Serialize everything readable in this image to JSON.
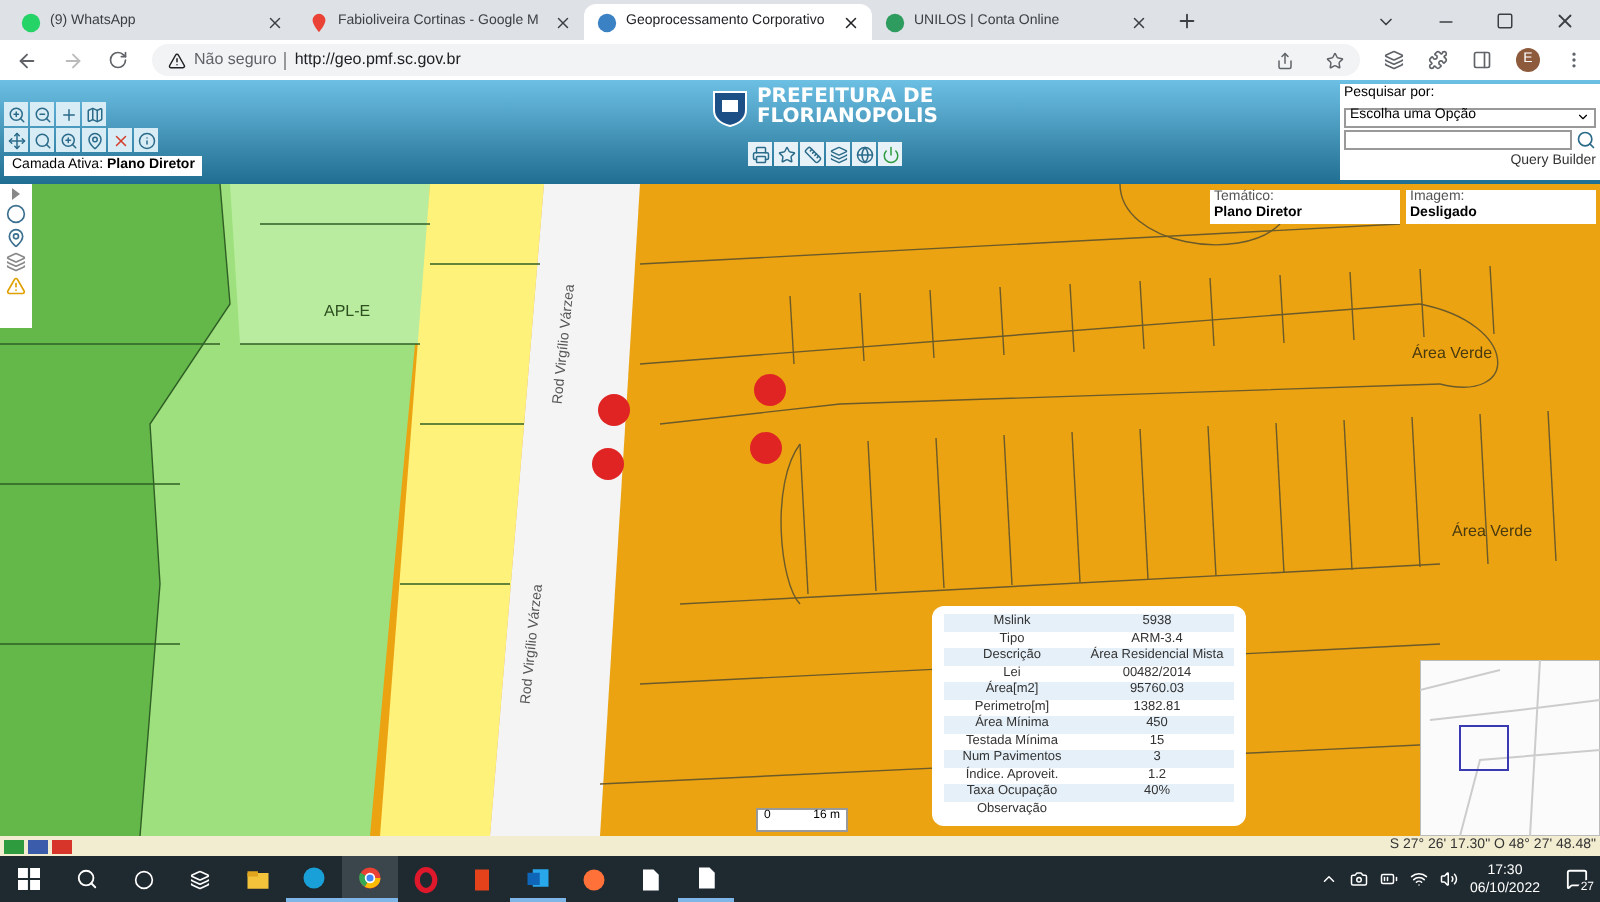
{
  "browser": {
    "tabs": [
      {
        "title": "(9) WhatsApp",
        "kind": "whatsapp",
        "selected": false
      },
      {
        "title": "Fabioliveira Cortinas - Google M",
        "kind": "maps",
        "selected": false
      },
      {
        "title": "Geoprocessamento Corporativo",
        "kind": "globe",
        "selected": true
      },
      {
        "title": "UNILOS | Conta Online",
        "kind": "unilos",
        "selected": false
      }
    ],
    "address": {
      "security": "Não seguro",
      "url": "http://geo.pmf.sc.gov.br"
    },
    "profile": "E"
  },
  "header": {
    "logo_lines": [
      "PREFEITURA DE",
      "FLORIANOPOLIS"
    ],
    "active_layer": {
      "label": "Camada Ativa:",
      "value": "Plano Diretor"
    },
    "search": {
      "label": "Pesquisar por:",
      "select": "Escolha uma Opção",
      "query_builder": "Query Builder"
    }
  },
  "map": {
    "thematic": {
      "label": "Temático:",
      "value": "Plano Diretor"
    },
    "image": {
      "label": "Imagem:",
      "value": "Desligado"
    },
    "zone_label": "APL-E",
    "area_labels": [
      "Área Verde",
      "Área Verde"
    ],
    "road_labels": [
      "Rod Virgílio Várzea",
      "Rod Virgílio Várzea"
    ],
    "info": [
      {
        "label": "Mslink",
        "value": "5938"
      },
      {
        "label": "Tipo",
        "value": "ARM-3.4"
      },
      {
        "label": "Descrição",
        "value": "Área Residencial Mista"
      },
      {
        "label": "Lei",
        "value": "00482/2014"
      },
      {
        "label": "Área[m2]",
        "value": "95760.03"
      },
      {
        "label": "Perimetro[m]",
        "value": "1382.81"
      },
      {
        "label": "Área Mínima",
        "value": "450"
      },
      {
        "label": "Testada Mínima",
        "value": "15"
      },
      {
        "label": "Num Pavimentos",
        "value": "3"
      },
      {
        "label": "Índice. Aproveit.",
        "value": "1.2"
      },
      {
        "label": "Taxa Ocupação",
        "value": "40%"
      },
      {
        "label": "Observação"
      }
    ],
    "scale": {
      "start": "0",
      "end": "16 m"
    },
    "coordinates": "S 27° 26' 17.30\" O 48° 27' 48.48\""
  },
  "taskbar": {
    "apps": [
      {
        "kind": "explorer",
        "running": false,
        "selected": false
      },
      {
        "kind": "edge",
        "running": true,
        "selected": false
      },
      {
        "kind": "chrome",
        "running": true,
        "selected": true
      },
      {
        "kind": "opera",
        "running": false,
        "selected": false
      },
      {
        "kind": "office",
        "running": false,
        "selected": false
      },
      {
        "kind": "outlook",
        "running": true,
        "selected": false
      },
      {
        "kind": "firefox",
        "running": false,
        "selected": false
      },
      {
        "kind": "file",
        "running": false,
        "selected": false
      },
      {
        "kind": "file",
        "running": true,
        "selected": false
      }
    ],
    "time": "17:30",
    "date": "06/10/2022",
    "notifications": "27"
  }
}
